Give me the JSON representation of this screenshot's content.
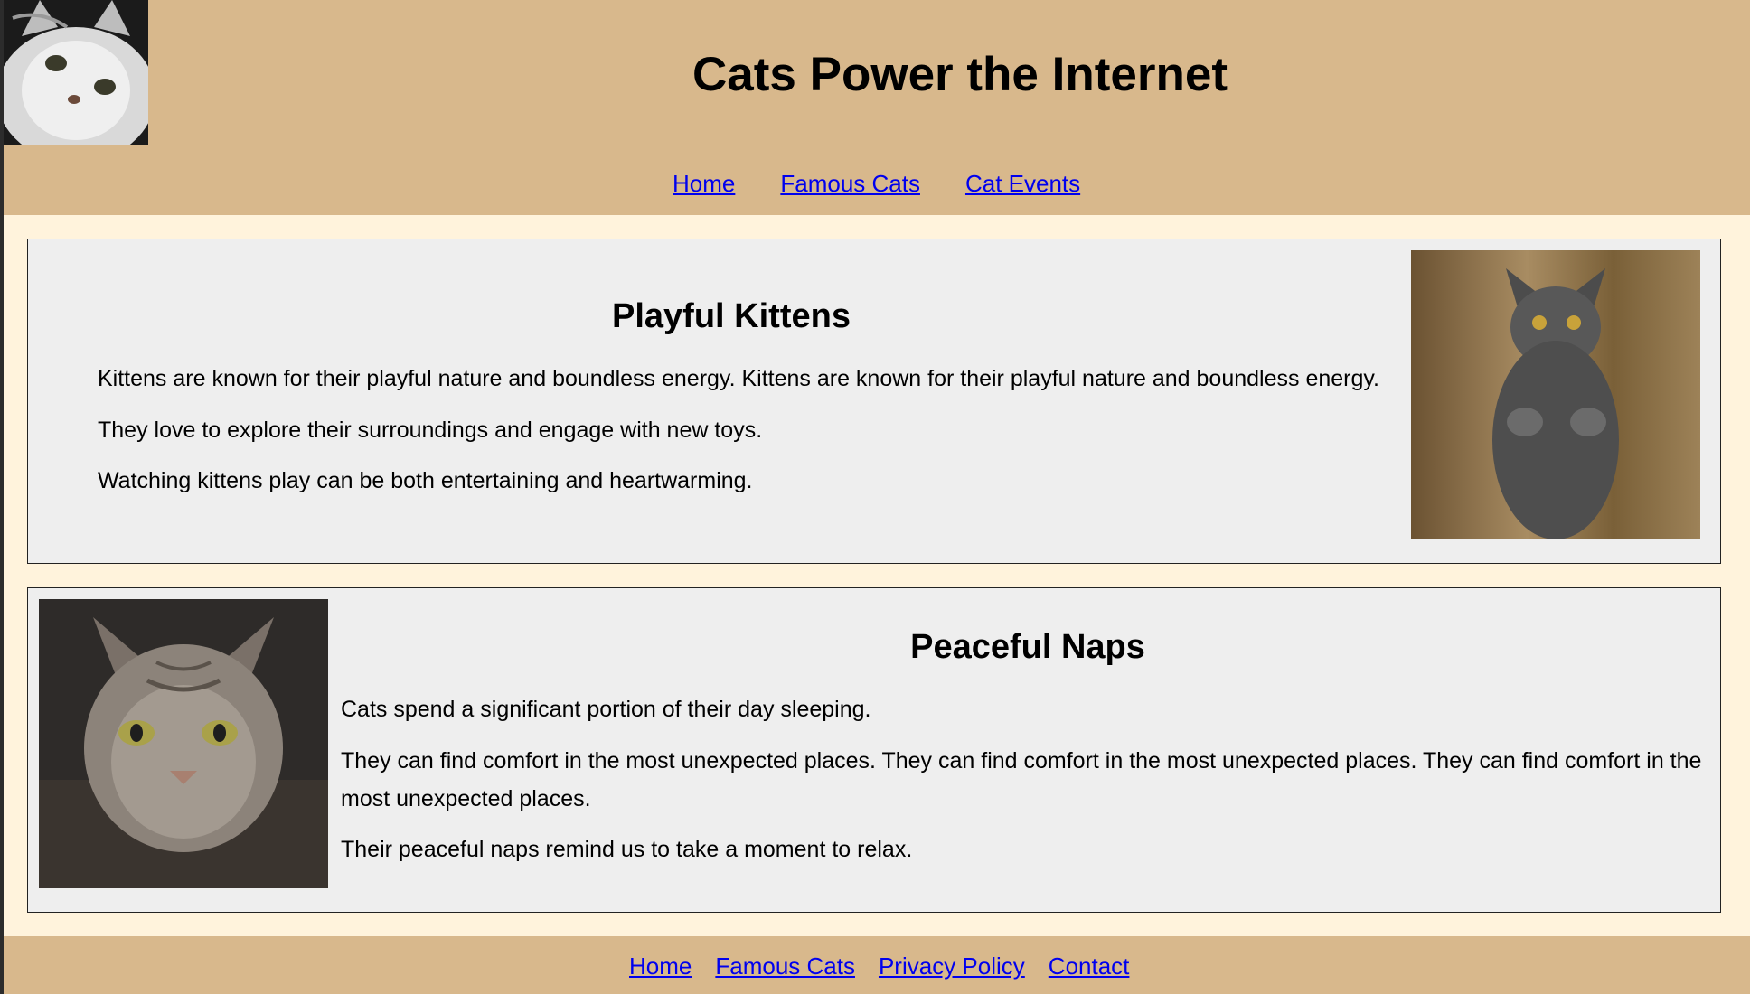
{
  "header": {
    "title": "Cats Power the Internet",
    "logo_icon": "cat-face-icon"
  },
  "nav": {
    "items": [
      {
        "label": "Home"
      },
      {
        "label": "Famous Cats"
      },
      {
        "label": "Cat Events"
      }
    ]
  },
  "sections": [
    {
      "heading": "Playful Kittens",
      "paragraphs": [
        "Kittens are known for their playful nature and boundless energy. Kittens are known for their playful nature and boundless energy.",
        "They love to explore their surroundings and engage with new toys.",
        "Watching kittens play can be both entertaining and heartwarming."
      ],
      "image_icon": "gray-kitten-photo"
    },
    {
      "heading": "Peaceful Naps",
      "paragraphs": [
        "Cats spend a significant portion of their day sleeping.",
        "They can find comfort in the most unexpected places. They can find comfort in the most unexpected places. They can find comfort in the most unexpected places.",
        "Their peaceful naps remind us to take a moment to relax."
      ],
      "image_icon": "tabby-cat-photo"
    }
  ],
  "footer": {
    "links": [
      {
        "label": "Home"
      },
      {
        "label": "Famous Cats"
      },
      {
        "label": "Privacy Policy"
      },
      {
        "label": "Contact"
      }
    ]
  },
  "colors": {
    "header_bg": "#d8b88c",
    "page_bg": "#fff3dc",
    "section_bg": "#eeeeee",
    "link": "#0000ee"
  }
}
